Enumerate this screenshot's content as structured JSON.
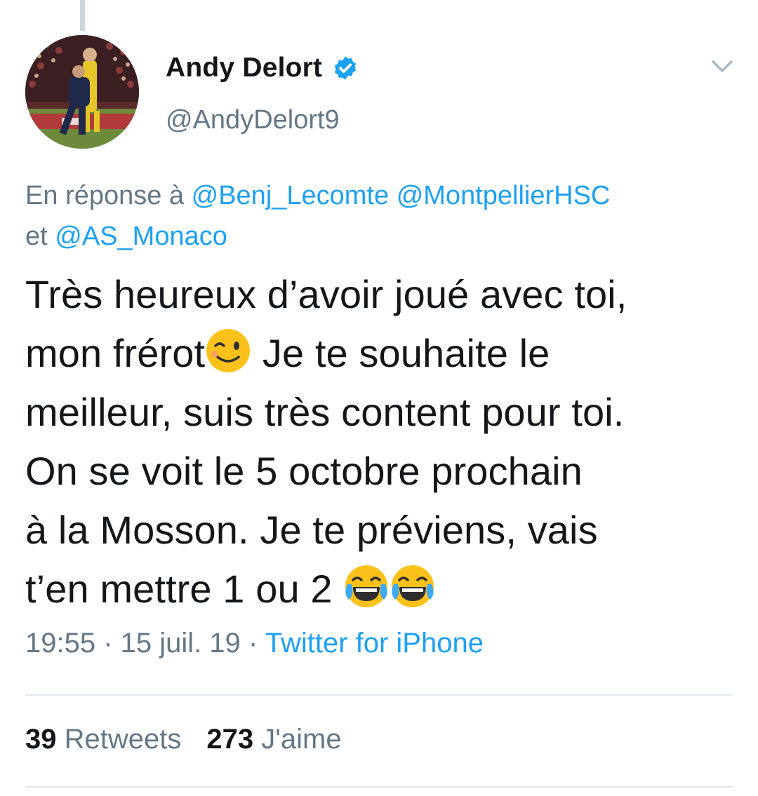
{
  "author": {
    "name": "Andy Delort",
    "handle": "@AndyDelort9",
    "verified": true,
    "avatar_icon": "soccer-player-photo"
  },
  "reply": {
    "prefix": "En réponse à",
    "mention1": "@Benj_Lecomte",
    "mention2": "@MontpellierHSC",
    "conjunction": "et",
    "mention3": "@AS_Monaco"
  },
  "tweet": {
    "line1": "Très heureux d’avoir joué avec toi,",
    "line2a": "mon frérot",
    "line2b": " Je te souhaite le",
    "line3": "meilleur, suis très content pour toi.",
    "line4": "On se voit le 5 octobre prochain",
    "line5": "à la Mosson. Je te préviens, vais",
    "line6": "t’en mettre 1 ou 2 ",
    "emojis": [
      "winking-face-emoji",
      "tears-of-joy-emoji",
      "tears-of-joy-emoji"
    ]
  },
  "meta": {
    "time": "19:55",
    "sep1": " · ",
    "date": "15 juil. 19",
    "sep2": " · ",
    "source": "Twitter for iPhone"
  },
  "stats": {
    "retweets_count": "39",
    "retweets_label": "Retweets",
    "likes_count": "273",
    "likes_label": "J'aime"
  },
  "colors": {
    "accent": "#1da1f2",
    "muted": "#657786",
    "text": "#14171a",
    "divider": "#e1e8ed"
  }
}
